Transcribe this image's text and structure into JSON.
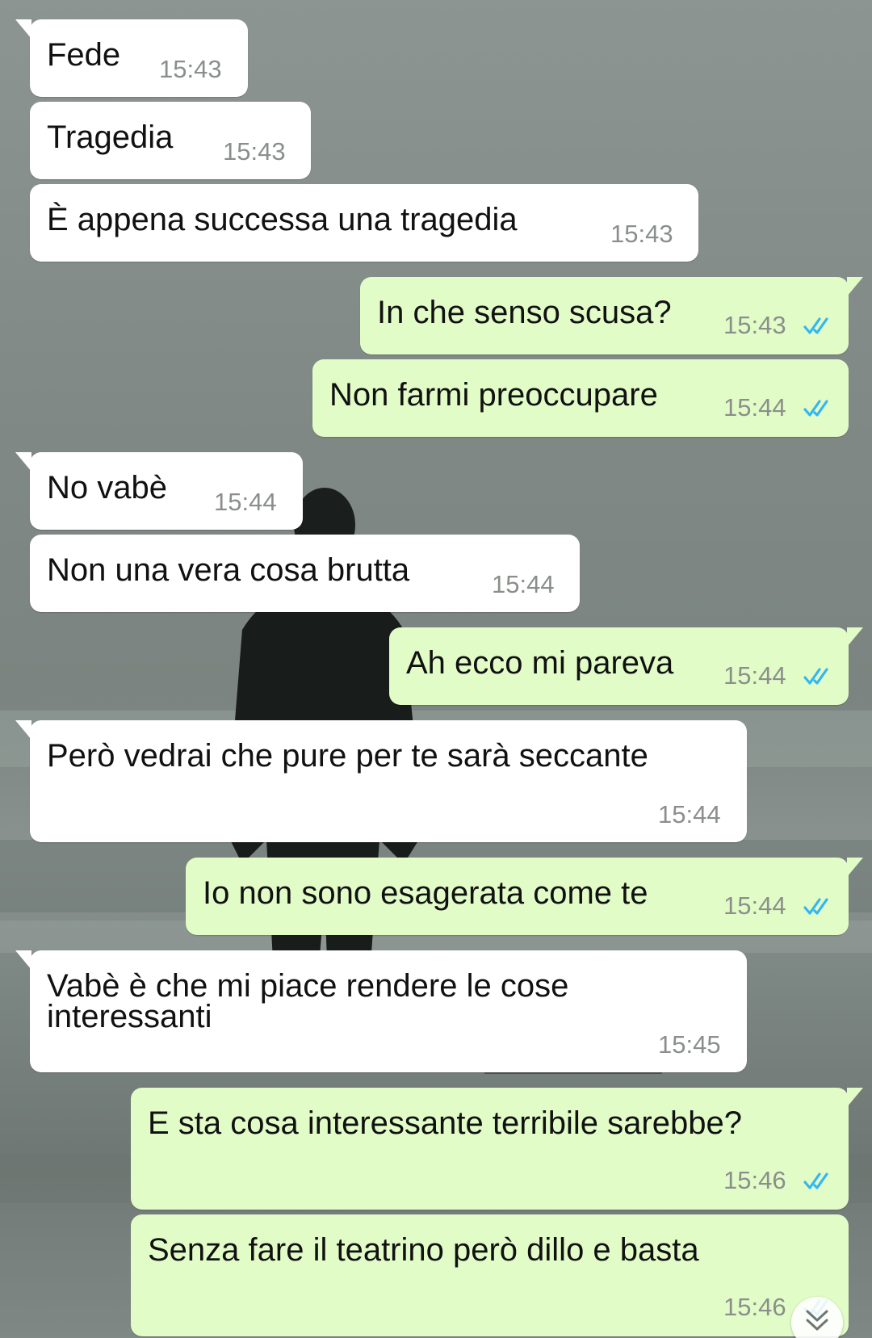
{
  "chat": {
    "messages": [
      {
        "text": "Fede",
        "time": "15:43",
        "direction": "incoming"
      },
      {
        "text": "Tragedia",
        "time": "15:43",
        "direction": "incoming"
      },
      {
        "text": "È appena successa una tragedia",
        "time": "15:43",
        "direction": "incoming"
      },
      {
        "text": "In che senso scusa?",
        "time": "15:43",
        "direction": "outgoing",
        "status": "read"
      },
      {
        "text": "Non farmi preoccupare",
        "time": "15:44",
        "direction": "outgoing",
        "status": "read"
      },
      {
        "text": "No vabè",
        "time": "15:44",
        "direction": "incoming"
      },
      {
        "text": "Non una vera cosa brutta",
        "time": "15:44",
        "direction": "incoming"
      },
      {
        "text": "Ah ecco mi pareva",
        "time": "15:44",
        "direction": "outgoing",
        "status": "read"
      },
      {
        "text": "Però vedrai che pure per te sarà seccante",
        "time": "15:44",
        "direction": "incoming"
      },
      {
        "text": "Io non sono esagerata come te",
        "time": "15:44",
        "direction": "outgoing",
        "status": "read"
      },
      {
        "lines": [
          "Vabè è che mi piace rendere le cose",
          "interessanti"
        ],
        "time": "15:45",
        "direction": "incoming"
      },
      {
        "text": "E sta cosa interessante terribile sarebbe?",
        "time": "15:46",
        "direction": "outgoing",
        "status": "read"
      },
      {
        "text": "Senza fare il teatrino però dillo e basta",
        "time": "15:46",
        "direction": "outgoing",
        "status": "read"
      }
    ],
    "scroll_button_icon": "double-chevron-down-icon",
    "read_icon": "double-check-icon",
    "colors": {
      "incoming_bubble": "#ffffff",
      "outgoing_bubble": "#e2fcc8",
      "read_ticks": "#34b7f1",
      "timestamp": "#8b8f8b"
    }
  }
}
